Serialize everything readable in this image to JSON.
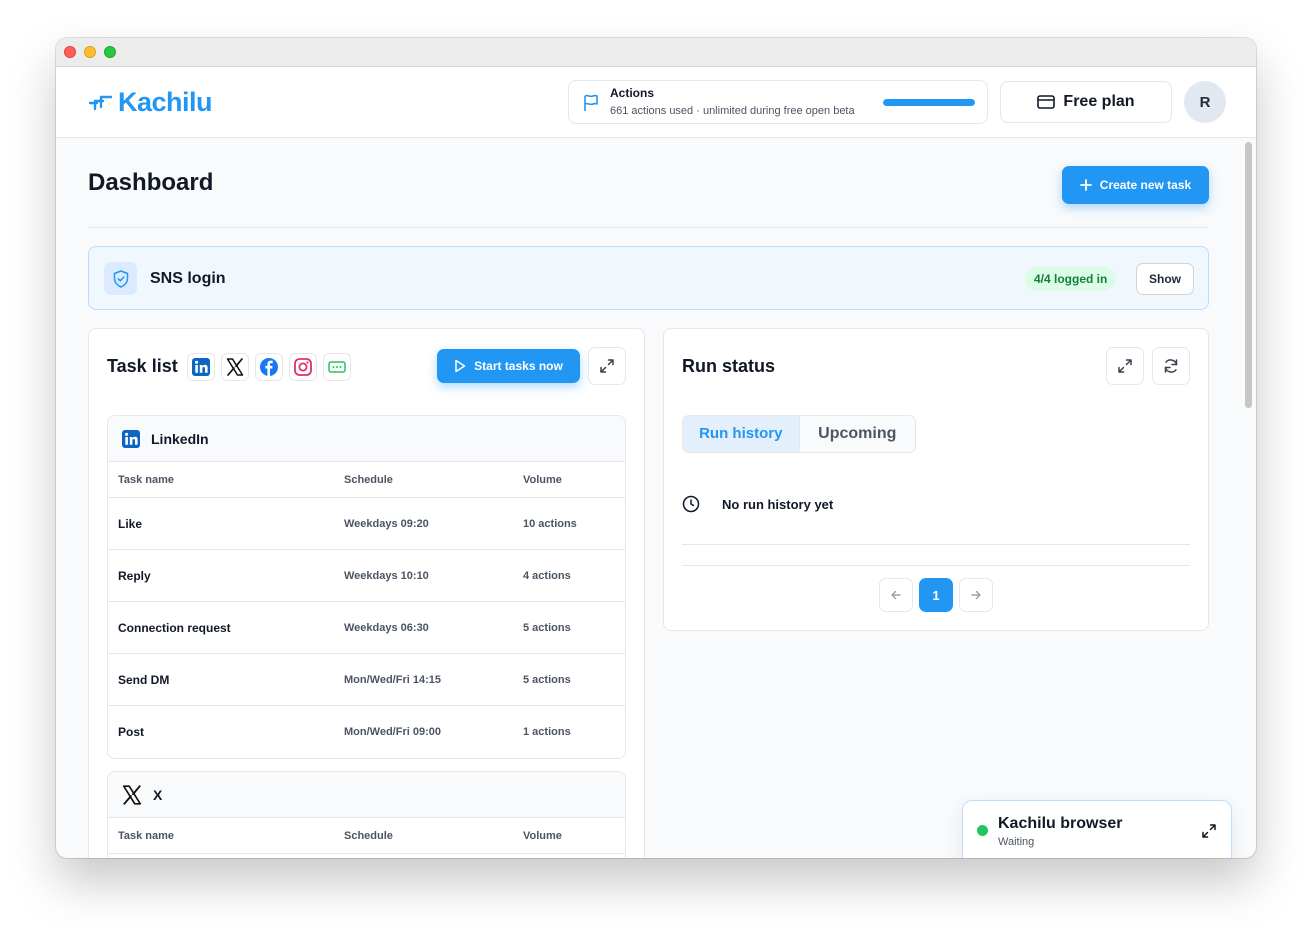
{
  "header": {
    "logo_text": "Kachilu",
    "actions": {
      "title": "Actions",
      "subtitle": "661 actions used · unlimited during free open beta",
      "progress": 1.0
    },
    "plan_label": "Free plan",
    "avatar_initial": "R"
  },
  "page": {
    "title": "Dashboard",
    "create_button": "Create new task"
  },
  "sns_login": {
    "title": "SNS login",
    "status": "4/4 logged in",
    "show_button": "Show"
  },
  "task_list": {
    "title": "Task list",
    "platform_icons": [
      "linkedin-icon",
      "x-icon",
      "facebook-icon",
      "instagram-icon",
      "sms-icon"
    ],
    "start_button": "Start tasks now",
    "columns": [
      "Task name",
      "Schedule",
      "Volume"
    ],
    "platforms": [
      {
        "name": "LinkedIn",
        "rows": [
          {
            "name": "Like",
            "schedule": "Weekdays 09:20",
            "volume": "10 actions"
          },
          {
            "name": "Reply",
            "schedule": "Weekdays 10:10",
            "volume": "4 actions"
          },
          {
            "name": "Connection request",
            "schedule": "Weekdays 06:30",
            "volume": "5 actions"
          },
          {
            "name": "Send DM",
            "schedule": "Mon/Wed/Fri 14:15",
            "volume": "5 actions"
          },
          {
            "name": "Post",
            "schedule": "Mon/Wed/Fri 09:00",
            "volume": "1 actions"
          }
        ]
      },
      {
        "name": "X",
        "rows": []
      }
    ]
  },
  "run_status": {
    "title": "Run status",
    "tabs": [
      {
        "label": "Run history",
        "active": true
      },
      {
        "label": "Upcoming",
        "active": false
      }
    ],
    "empty_message": "No run history yet",
    "pagination": {
      "current": "1"
    }
  },
  "browser_widget": {
    "title": "Kachilu browser",
    "status": "Waiting",
    "status_color": "#22c55e"
  },
  "colors": {
    "accent": "#2196f3",
    "success": "#15803d"
  }
}
